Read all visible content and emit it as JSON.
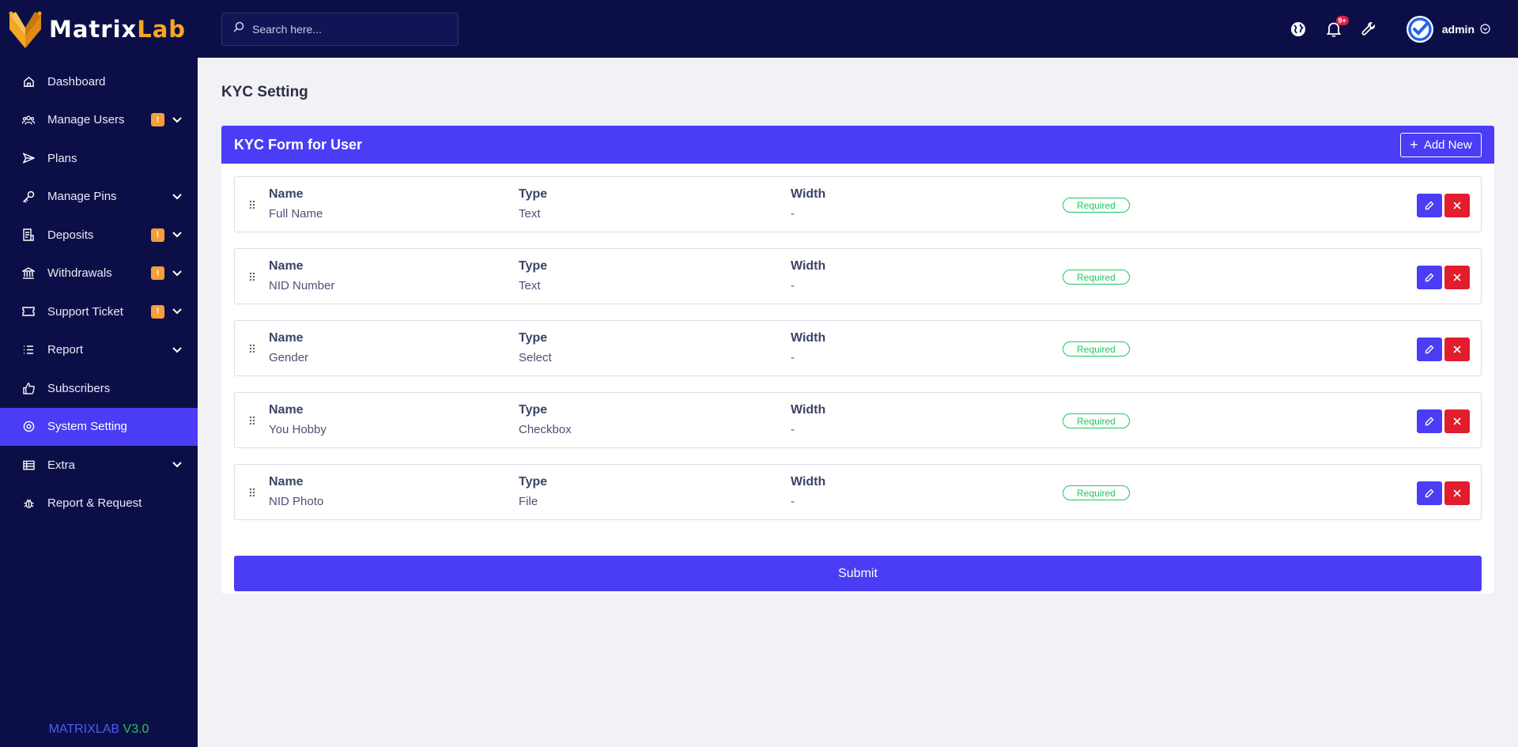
{
  "brand": {
    "part1": "Matrix",
    "part2": "Lab"
  },
  "search": {
    "placeholder": "Search here..."
  },
  "sidebar": {
    "items": [
      {
        "label": "Dashboard",
        "icon": "home-icon",
        "badge": "",
        "chevron": false
      },
      {
        "label": "Manage Users",
        "icon": "users-icon",
        "badge": "!",
        "chevron": true
      },
      {
        "label": "Plans",
        "icon": "send-icon",
        "badge": "",
        "chevron": false
      },
      {
        "label": "Manage Pins",
        "icon": "key-icon",
        "badge": "",
        "chevron": true
      },
      {
        "label": "Deposits",
        "icon": "receipt-icon",
        "badge": "!",
        "chevron": true
      },
      {
        "label": "Withdrawals",
        "icon": "bank-icon",
        "badge": "!",
        "chevron": true
      },
      {
        "label": "Support Ticket",
        "icon": "ticket-icon",
        "badge": "!",
        "chevron": true
      },
      {
        "label": "Report",
        "icon": "list-icon",
        "badge": "",
        "chevron": true
      },
      {
        "label": "Subscribers",
        "icon": "thumbs-up-icon",
        "badge": "",
        "chevron": false
      },
      {
        "label": "System Setting",
        "icon": "settings-icon",
        "badge": "",
        "chevron": false,
        "active": true
      },
      {
        "label": "Extra",
        "icon": "table-icon",
        "badge": "",
        "chevron": true
      },
      {
        "label": "Report & Request",
        "icon": "bug-icon",
        "badge": "",
        "chevron": false
      }
    ],
    "version": {
      "name": "MATRIXLAB",
      "number": "V3.0"
    }
  },
  "topbar": {
    "notification_count": "9+",
    "user_name": "admin"
  },
  "page": {
    "title": "KYC Setting",
    "card_title": "KYC Form for User",
    "add_button": "Add New",
    "submit_button": "Submit",
    "labels": {
      "name": "Name",
      "type": "Type",
      "width": "Width"
    },
    "fields": [
      {
        "name": "Full Name",
        "type": "Text",
        "width": "-",
        "status": "Required"
      },
      {
        "name": "NID Number",
        "type": "Text",
        "width": "-",
        "status": "Required"
      },
      {
        "name": "Gender",
        "type": "Select",
        "width": "-",
        "status": "Required"
      },
      {
        "name": "You Hobby",
        "type": "Checkbox",
        "width": "-",
        "status": "Required"
      },
      {
        "name": "NID Photo",
        "type": "File",
        "width": "-",
        "status": "Required"
      }
    ]
  },
  "colors": {
    "sidebar_bg": "#0c0f47",
    "accent": "#4a3df5",
    "danger": "#e11d2e",
    "success": "#22c55e",
    "warning": "#f59e3b",
    "brand_orange": "#f5a623"
  }
}
